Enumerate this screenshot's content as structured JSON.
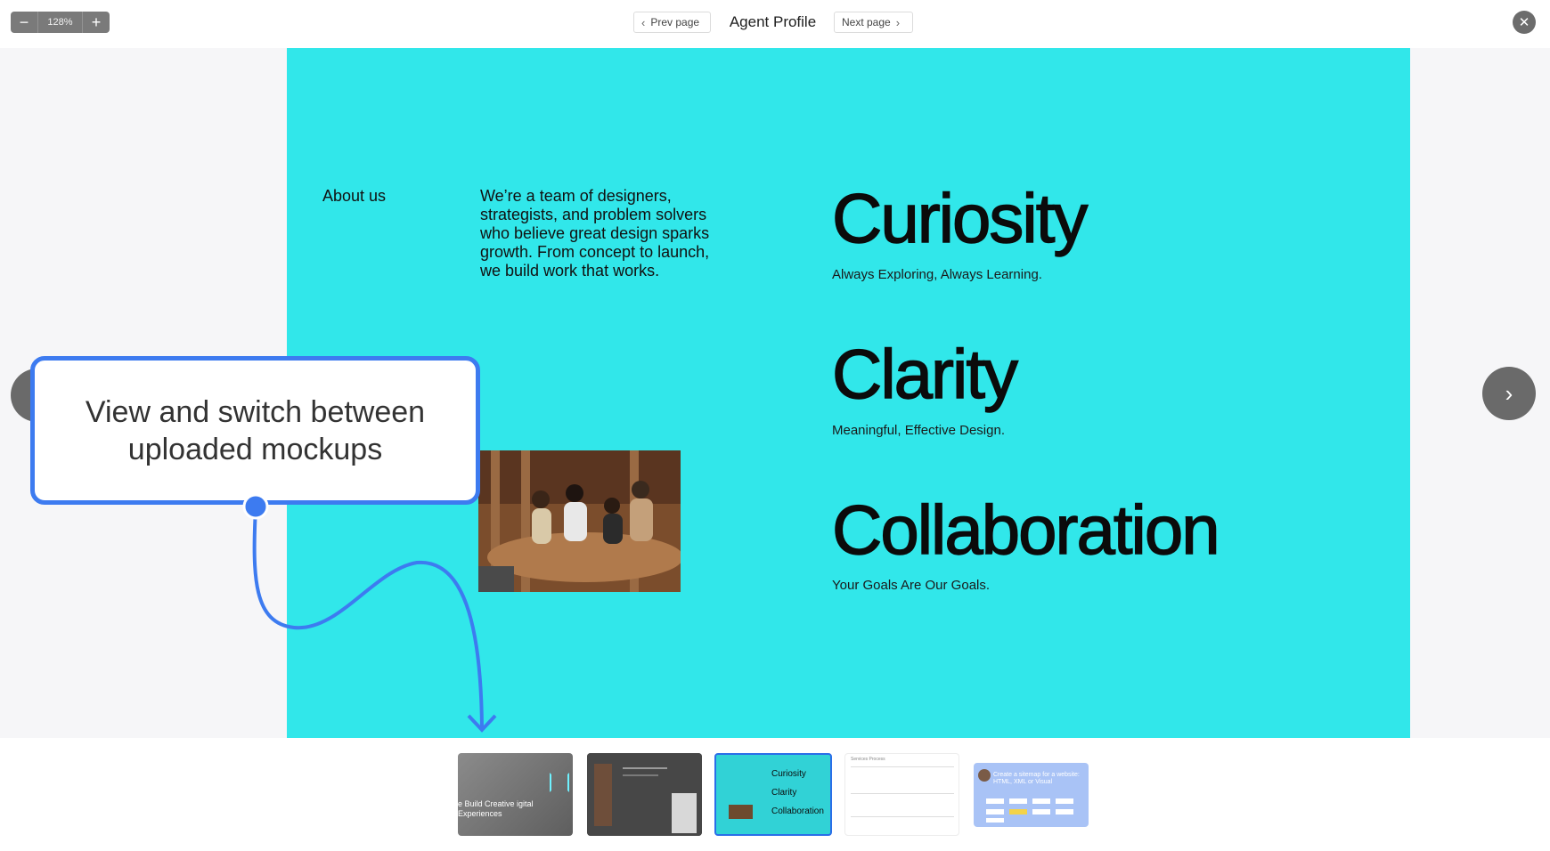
{
  "toolbar": {
    "zoom_out": "−",
    "zoom_value": "128%",
    "zoom_in": "+",
    "prev_label": "Prev page",
    "title": "Agent Profile",
    "next_label": "Next page",
    "close": "✕"
  },
  "slide": {
    "about_label": "About us",
    "paragraph": "We’re a team of designers, strategists, and problem solvers who believe great design sparks growth. From concept to launch, we build work that works.",
    "values": [
      {
        "word": "Curiosity",
        "tagline": "Always Exploring, Always Learning."
      },
      {
        "word": "Clarity",
        "tagline": "Meaningful, Effective Design."
      },
      {
        "word": "Collaboration",
        "tagline": "Your Goals Are Our Goals."
      }
    ],
    "background_color": "#31e7ea"
  },
  "callout": {
    "text": "View and switch between uploaded mockups",
    "accent_color": "#3d7bf0"
  },
  "thumbnails": [
    {
      "text": "e Build Creative igital Experiences"
    },
    {
      "text": ""
    },
    {
      "words": [
        "Curiosity",
        "Clarity",
        "Collaboration"
      ],
      "selected": true
    },
    {
      "text": "Services Process"
    },
    {
      "text": "Create a sitemap for a website: HTML, XML or Visual"
    }
  ]
}
